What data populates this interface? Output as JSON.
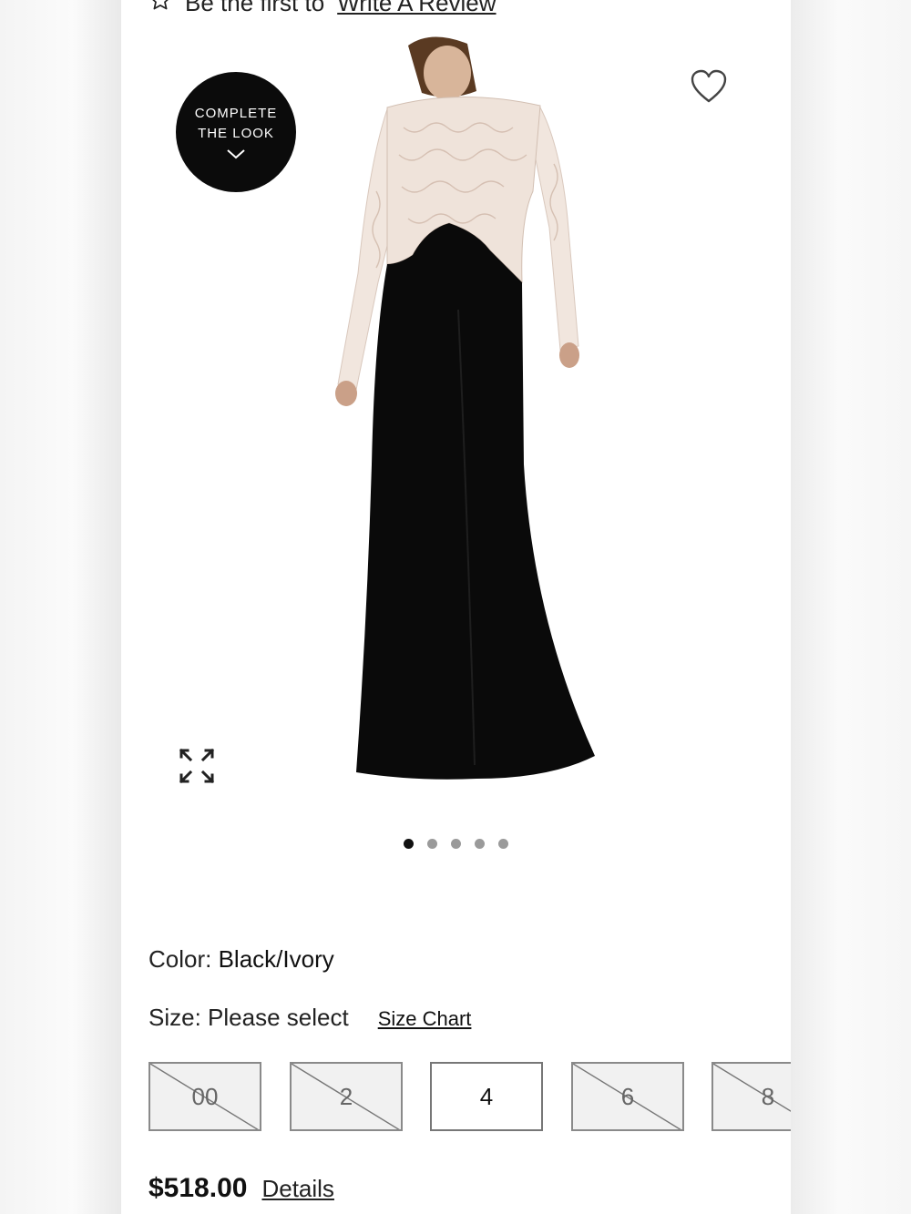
{
  "review": {
    "prefix": "Be the first to",
    "link": "Write A Review"
  },
  "gallery": {
    "complete_look_line1": "COMPLETE",
    "complete_look_line2": "THE LOOK",
    "dots_total": 5,
    "active_dot": 1
  },
  "product": {
    "color_label": "Color:",
    "color_value": "Black/Ivory",
    "size_label": "Size:",
    "size_value": "Please select",
    "size_chart_link": "Size Chart",
    "sizes": [
      {
        "label": "00",
        "available": false
      },
      {
        "label": "2",
        "available": false
      },
      {
        "label": "4",
        "available": true
      },
      {
        "label": "6",
        "available": false
      },
      {
        "label": "8",
        "available": false
      }
    ],
    "price": "$518.00",
    "details_link": "Details"
  },
  "colors": {
    "accent": "#0b0b0b",
    "panel": "#ffffff",
    "disabled_size_bg": "#f1f1f1",
    "dot_inactive": "#9a9a9a"
  },
  "icons": {
    "review_star": "star-outline-icon",
    "wishlist": "heart-outline-icon",
    "expand": "expand-arrows-icon",
    "complete_look_chevron": "chevron-down-icon"
  }
}
